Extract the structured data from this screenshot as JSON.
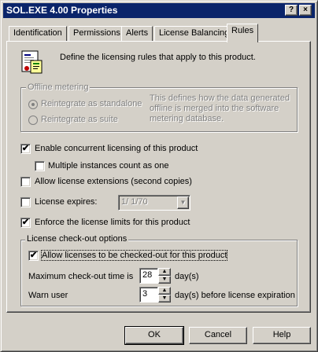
{
  "window": {
    "title": "SOL.EXE 4.00 Properties",
    "help_glyph": "?",
    "close_glyph": "×"
  },
  "tabs": [
    {
      "label": "Identification",
      "active": false
    },
    {
      "label": "Permissions",
      "active": false
    },
    {
      "label": "Alerts",
      "active": false
    },
    {
      "label": "License Balancing",
      "active": false
    },
    {
      "label": "Rules",
      "active": true
    }
  ],
  "header": {
    "icon": "license-document-icon",
    "description": "Define the licensing rules that apply to this product."
  },
  "offline_metering": {
    "legend": "Offline metering",
    "option1_label": "Reintegrate as standalone",
    "option2_label": "Reintegrate as suite",
    "selected": "Reintegrate as standalone",
    "info_line1": "This defines how the data generated",
    "info_line2": "offline is merged into the software",
    "info_line3": "metering database."
  },
  "options": {
    "concurrent": {
      "label": "Enable concurrent licensing of this product",
      "checked": true
    },
    "multiple_instances": {
      "label": "Multiple instances count as one",
      "checked": false
    },
    "extensions": {
      "label": "Allow license extensions (second copies)",
      "checked": false
    },
    "expires": {
      "label": "License expires:",
      "checked": false,
      "date_value": "1/ 1/70"
    },
    "enforce": {
      "label": "Enforce the license limits for this product",
      "checked": true
    }
  },
  "checkout": {
    "legend": "License check-out options",
    "allow": {
      "label": "Allow licenses to be checked-out for this product",
      "checked": true
    },
    "max_time_label": "Maximum check-out time is",
    "max_time_value": "28",
    "max_time_unit": "day(s)",
    "warn_label": "Warn user",
    "warn_value": "3",
    "warn_unit": "day(s) before license expiration"
  },
  "buttons": {
    "ok": "OK",
    "cancel": "Cancel",
    "help": "Help"
  },
  "glyphs": {
    "check": "✔",
    "up": "▲",
    "down": "▼"
  }
}
